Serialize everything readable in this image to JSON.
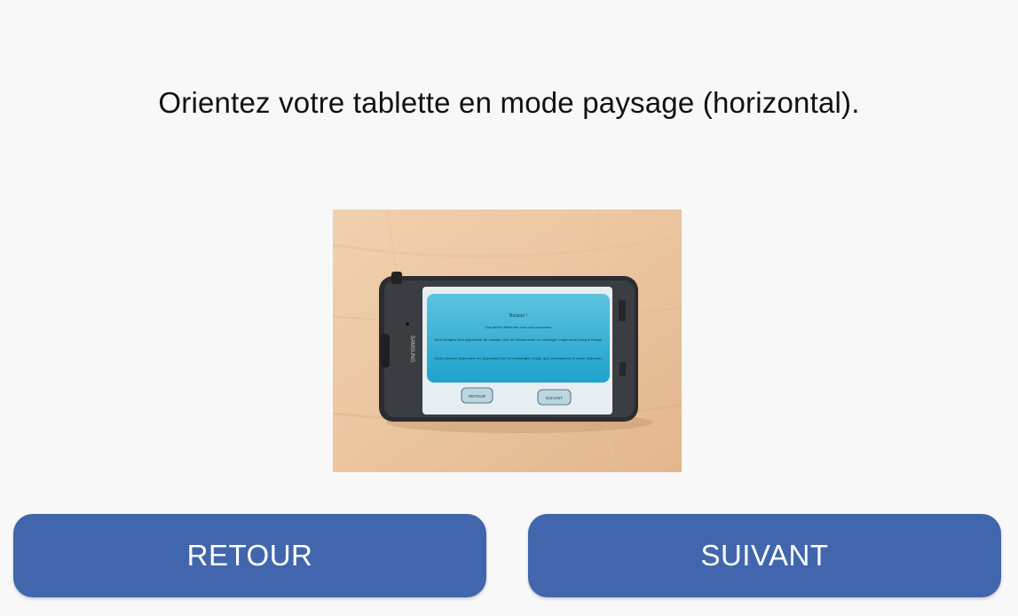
{
  "instruction": "Orientez votre tablette en mode paysage (horizontal).",
  "illustration": {
    "device_brand": "SAMSUNG",
    "screen_texts": {
      "greeting": "Bonjour !",
      "line1": "Cinq tâches différentes vous sont proposées.",
      "line2": "Deux images vont apparaître de chaque côté de l'écran avec un rectangle rouge sous chaque image.",
      "line3": "Vous devrez répondre en appuyant sur le rectangle rouge qui correspond à votre réponse.",
      "back": "RETOUR",
      "next": "SUIVANT"
    }
  },
  "buttons": {
    "back_label": "RETOUR",
    "next_label": "SUIVANT"
  },
  "colors": {
    "background": "#f8f8f8",
    "button": "#4266ad",
    "button_text": "#ffffff"
  }
}
